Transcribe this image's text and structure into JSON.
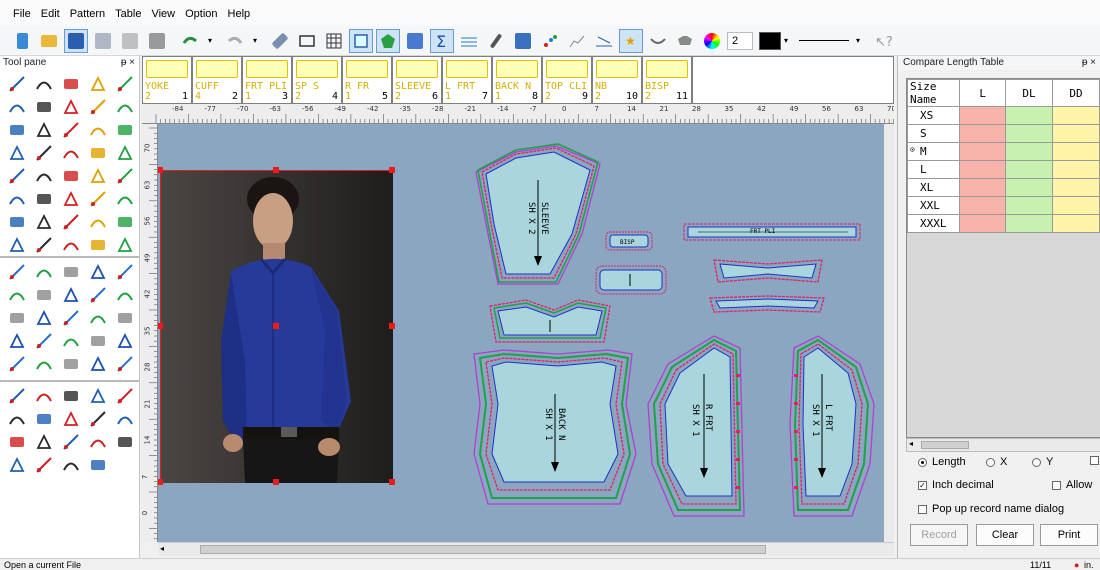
{
  "menu": [
    "File",
    "Edit",
    "Pattern",
    "Table",
    "View",
    "Option",
    "Help"
  ],
  "toolbar": {
    "line_width_value": "2",
    "color": "#000000"
  },
  "tool_pane": {
    "title": "Tool pane",
    "pin": "ᵽ ×"
  },
  "pieces": [
    {
      "name": "YOKE",
      "count": "2",
      "index": "1"
    },
    {
      "name": "CUFF",
      "count": "4",
      "index": "2"
    },
    {
      "name": "FRT PLI",
      "count": "1",
      "index": "3"
    },
    {
      "name": "SP S",
      "count": "2",
      "index": "4"
    },
    {
      "name": "R FR",
      "count": "1",
      "index": "5"
    },
    {
      "name": "SLEEVE",
      "count": "2",
      "index": "6"
    },
    {
      "name": "L FRT",
      "count": "1",
      "index": "7"
    },
    {
      "name": "BACK N",
      "count": "1",
      "index": "8"
    },
    {
      "name": "TOP CLI",
      "count": "2",
      "index": "9"
    },
    {
      "name": "NB",
      "count": "2",
      "index": "10"
    },
    {
      "name": "BISP",
      "count": "2",
      "index": "11"
    }
  ],
  "ruler_top": [
    "-84",
    "-77",
    "-70",
    "-63",
    "-56",
    "-49",
    "-42",
    "-35",
    "-28",
    "-21",
    "-14",
    "-7",
    "0",
    "7",
    "14",
    "21",
    "28",
    "35",
    "42",
    "49",
    "56",
    "63",
    "70"
  ],
  "ruler_left": [
    "70",
    "63",
    "56",
    "49",
    "42",
    "35",
    "28",
    "21",
    "14",
    "7",
    "0"
  ],
  "canvas_labels": {
    "sleeve": "SLEEVE",
    "sleeve_qty": "SH X 2",
    "back": "BACK N",
    "back_qty": "SH X 1",
    "rfrt": "R FRT",
    "rfrt_qty": "SH X 1",
    "lfrt": "L FRT",
    "lfrt_qty": "SH X 1",
    "bisp": "BISP",
    "frtpli": "FRT PLI"
  },
  "compare_table": {
    "title": "Compare Length Table",
    "pin": "ᵽ ×",
    "headers": [
      "Size Name",
      "L",
      "DL",
      "DD"
    ],
    "sizes": [
      "XS",
      "S",
      "M",
      "L",
      "XL",
      "XXL",
      "XXXL"
    ],
    "selected_size": "M"
  },
  "options": {
    "length_label": "Length",
    "x_label": "X",
    "y_label": "Y",
    "inch_decimal_label": "Inch decimal",
    "allow_label": "Allow",
    "popup_label": "Pop up record name dialog"
  },
  "buttons": {
    "record": "Record",
    "clear": "Clear",
    "print": "Print"
  },
  "status": {
    "message": "Open a current File",
    "page": "11/11",
    "unit": "in."
  },
  "colors": {
    "canvas_bg": "#8aa6c0",
    "piece_fill": "#a8d6dc",
    "seam_red": "#e0206a",
    "seam_green": "#22a04a",
    "seam_blue": "#2030c8",
    "seam_purple": "#b040d0"
  }
}
